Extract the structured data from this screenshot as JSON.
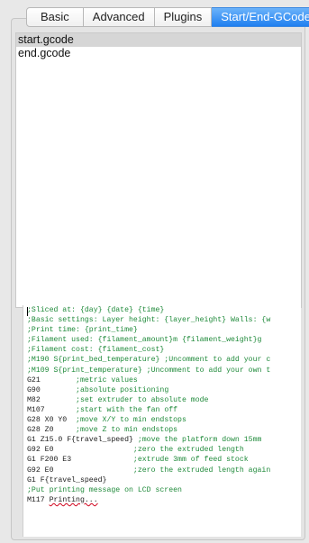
{
  "tabs": [
    {
      "label": "Basic",
      "active": false
    },
    {
      "label": "Advanced",
      "active": false
    },
    {
      "label": "Plugins",
      "active": false
    },
    {
      "label": "Start/End-GCode",
      "active": true
    }
  ],
  "files": [
    "start.gcode",
    "end.gcode"
  ],
  "editor": {
    "lines": [
      {
        "text": ";Sliced at: {day} {date} {time}",
        "type": "comment"
      },
      {
        "text": ";Basic settings: Layer height: {layer_height} Walls: {w",
        "type": "comment"
      },
      {
        "text": ";Print time: {print_time}",
        "type": "comment"
      },
      {
        "text": ";Filament used: {filament_amount}m {filament_weight}g",
        "type": "comment"
      },
      {
        "text": ";Filament cost: {filament_cost}",
        "type": "comment"
      },
      {
        "text": ";M190 S{print_bed_temperature} ;Uncomment to add your c",
        "type": "comment"
      },
      {
        "text": ";M109 S{print_temperature} ;Uncomment to add your own t",
        "type": "comment"
      },
      {
        "code": "G21        ",
        "comment": ";metric values",
        "type": "mixed"
      },
      {
        "code": "G90        ",
        "comment": ";absolute positioning",
        "type": "mixed"
      },
      {
        "code": "M82        ",
        "comment": ";set extruder to absolute mode",
        "type": "mixed"
      },
      {
        "code": "M107       ",
        "comment": ";start with the fan off",
        "type": "mixed"
      },
      {
        "code": "G28 X0 Y0  ",
        "comment": ";move X/Y to min endstops",
        "type": "mixed"
      },
      {
        "code": "G28 Z0     ",
        "comment": ";move Z to min endstops",
        "type": "mixed"
      },
      {
        "code": "G1 Z15.0 F{travel_speed} ",
        "comment": ";move the platform down 15mm",
        "type": "mixed"
      },
      {
        "code": "G92 E0                  ",
        "comment": ";zero the extruded length",
        "type": "mixed"
      },
      {
        "code": "G1 F200 E3              ",
        "comment": ";extrude 3mm of feed stock",
        "type": "mixed"
      },
      {
        "code": "G92 E0                  ",
        "comment": ";zero the extruded length again",
        "type": "mixed"
      },
      {
        "text": "G1 F{travel_speed}",
        "type": "code"
      },
      {
        "text": ";Put printing message on LCD screen",
        "type": "comment"
      },
      {
        "code": "M117 ",
        "squiggle": "Printing...",
        "type": "squiggle"
      }
    ]
  }
}
